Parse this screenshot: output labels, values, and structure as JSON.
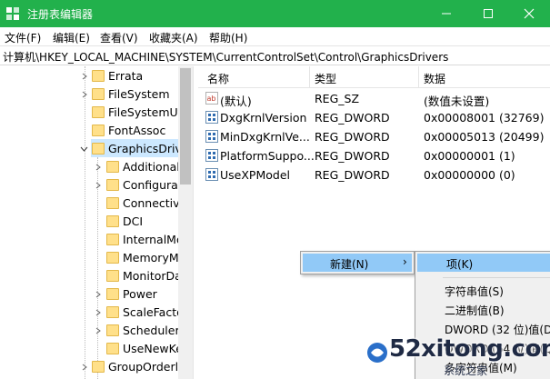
{
  "window": {
    "title": "注册表编辑器",
    "title_bar_color": "#22b14c"
  },
  "menu": [
    "文件(F)",
    "编辑(E)",
    "查看(V)",
    "收藏夹(A)",
    "帮助(H)"
  ],
  "address": "计算机\\HKEY_LOCAL_MACHINE\\SYSTEM\\CurrentControlSet\\Control\\GraphicsDrivers",
  "tree": {
    "items": [
      {
        "label": "Errata"
      },
      {
        "label": "FileSystem"
      },
      {
        "label": "FileSystemUti"
      },
      {
        "label": "FontAssoc"
      },
      {
        "label": "GraphicsDriv"
      },
      {
        "label": "Additional"
      },
      {
        "label": "Configurat"
      },
      {
        "label": "Connectivi"
      },
      {
        "label": "DCI"
      },
      {
        "label": "InternalMo"
      },
      {
        "label": "MemoryM"
      },
      {
        "label": "MonitorDa"
      },
      {
        "label": "Power"
      },
      {
        "label": "ScaleFacto"
      },
      {
        "label": "Scheduler"
      },
      {
        "label": "UseNewKe"
      },
      {
        "label": "GroupOrderl"
      }
    ]
  },
  "list": {
    "headers": {
      "name": "名称",
      "type": "类型",
      "data": "数据"
    },
    "rows": [
      {
        "name": "(默认)",
        "type": "REG_SZ",
        "data": "(数值未设置)",
        "icon": "string-value-icon"
      },
      {
        "name": "DxgKrnlVersion",
        "type": "REG_DWORD",
        "data": "0x00008001 (32769)",
        "icon": "binary-value-icon"
      },
      {
        "name": "MinDxgKrnlVe...",
        "type": "REG_DWORD",
        "data": "0x00005013 (20499)",
        "icon": "binary-value-icon"
      },
      {
        "name": "PlatformSuppo...",
        "type": "REG_DWORD",
        "data": "0x00000001 (1)",
        "icon": "binary-value-icon"
      },
      {
        "name": "UseXPModel",
        "type": "REG_DWORD",
        "data": "0x00000000 (0)",
        "icon": "binary-value-icon"
      }
    ]
  },
  "context_menu": {
    "new_label": "新建(N)",
    "submenu": [
      "项(K)",
      "字符串值(S)",
      "二进制值(B)",
      "DWORD (32 位)值(D)",
      "QWORD (64 位)值(Q)",
      "多字符串值(M)"
    ]
  },
  "watermark": {
    "brand": "52xitong.com",
    "sub": "系统之家"
  }
}
